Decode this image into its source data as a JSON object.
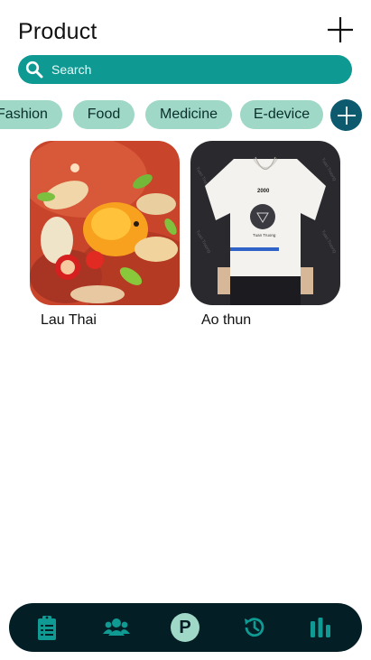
{
  "header": {
    "title": "Product",
    "add_icon": "plus-icon"
  },
  "search": {
    "placeholder": "Search",
    "icon": "search-icon"
  },
  "categories": [
    {
      "label": "Fashion"
    },
    {
      "label": "Food"
    },
    {
      "label": "Medicine"
    },
    {
      "label": "E-device"
    }
  ],
  "category_add_icon": "plus-circle-icon",
  "products": [
    {
      "name": "Lau Thai",
      "image": "hot-pot-soup-photo"
    },
    {
      "name": "Ao thun",
      "image": "white-tshirt-photo",
      "image_text": {
        "brand": "Tuan Truong",
        "number": "2000"
      }
    }
  ],
  "bottom_nav": {
    "items": [
      {
        "icon": "clipboard-icon"
      },
      {
        "icon": "users-icon"
      },
      {
        "icon": "product-p-icon",
        "label": "P",
        "active": true
      },
      {
        "icon": "history-icon"
      },
      {
        "icon": "bar-chart-icon"
      }
    ]
  },
  "colors": {
    "accent": "#0e9993",
    "chip": "#9fd8c7",
    "nav_bg": "#031e24",
    "nav_icon": "#0f9a93",
    "chip_add": "#0d5a6e"
  }
}
